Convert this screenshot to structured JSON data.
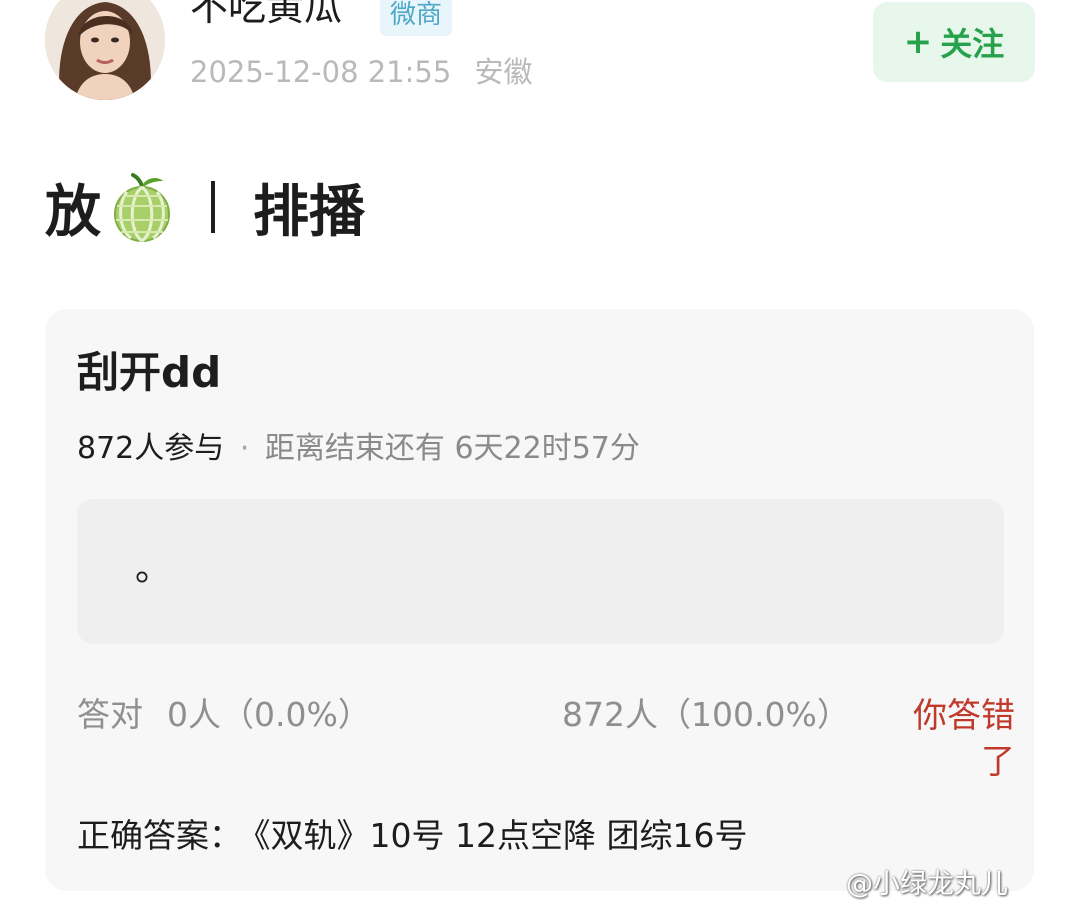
{
  "author": {
    "name": "不吃黄瓜",
    "badge": "微商",
    "timestamp": "2025-12-08 21:55",
    "location": "安徽",
    "follow_label": "关注",
    "follow_plus": "+"
  },
  "post": {
    "text_before": "放",
    "emoji": "melon-icon",
    "separator": "|",
    "text_after": "排播"
  },
  "quiz": {
    "title": "刮开dd",
    "participants": "872人参与",
    "separator": "·",
    "deadline": "距离结束还有 6天22时57分",
    "option_text": "。",
    "correct_label": "答对",
    "correct_stats": "0人（0.0%）",
    "wrong_stats": "872人（100.0%）",
    "user_result": "你答错了",
    "answer_label": "正确答案：",
    "answer_text": "《双轨》10号 12点空降 团综16号"
  },
  "watermark": "@小绿龙丸儿",
  "colors": {
    "follow_text": "#27a24b",
    "follow_bg": "#e8f7ec",
    "wrong_text": "#c0392b",
    "badge_text": "#4fa7c9",
    "card_bg": "#f7f7f7"
  }
}
